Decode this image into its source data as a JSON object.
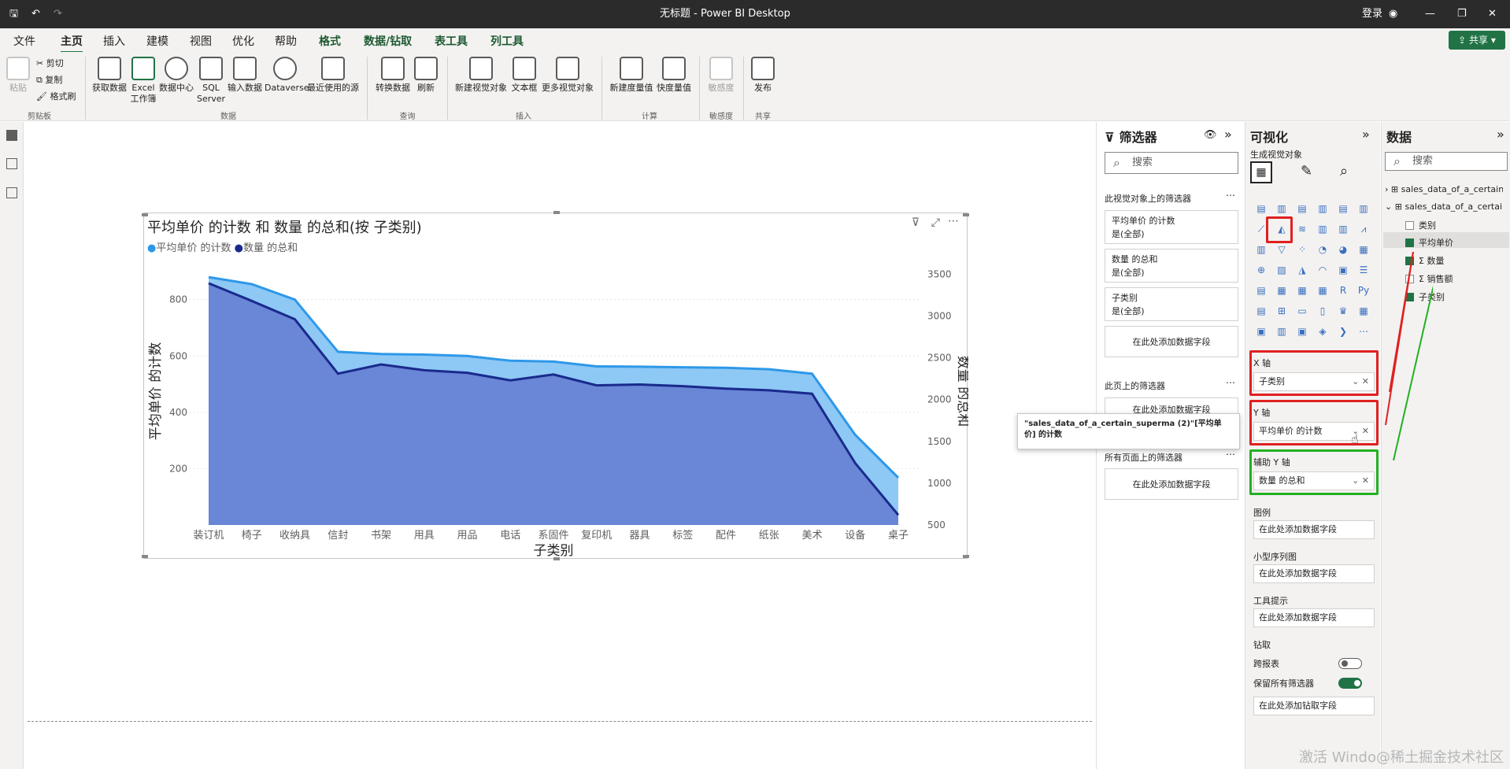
{
  "window": {
    "title": "无标题 - Power BI Desktop",
    "login": "登录",
    "share": "共享"
  },
  "tabs": [
    "文件",
    "主页",
    "插入",
    "建模",
    "视图",
    "优化",
    "帮助",
    "格式",
    "数据/钻取",
    "表工具",
    "列工具"
  ],
  "ribbon": {
    "clipboard": {
      "paste": "粘贴",
      "cut": "剪切",
      "copy": "复制",
      "format_painter": "格式刷",
      "group": "剪贴板"
    },
    "data": {
      "get_data": "获取数据",
      "excel": "Excel\n工作簿",
      "hub": "数据中心",
      "sql": "SQL\nServer",
      "enter": "输入数据",
      "dataverse": "Dataverse",
      "recent": "最近使用的源",
      "group": "数据"
    },
    "query": {
      "transform": "转换数据",
      "refresh": "刷新",
      "group": "查询"
    },
    "insert": {
      "new_visual": "新建视觉对象",
      "textbox": "文本框",
      "more": "更多视觉对象",
      "group": "插入"
    },
    "calc": {
      "new_measure": "新建度量值",
      "quick_measure": "快度量值",
      "group": "计算"
    },
    "sensitivity": {
      "label": "敏感度",
      "group": "敏感度"
    },
    "share": {
      "publish": "发布",
      "group": "共享"
    }
  },
  "visual": {
    "title": "平均单价 的计数 和 数量 的总和(按 子类别)",
    "legend1": "平均单价 的计数",
    "legend2": "数量 的总和"
  },
  "chart_data": {
    "type": "area",
    "title": "平均单价 的计数 和 数量 的总和(按 子类别)",
    "xlabel": "子类别",
    "ylabel": "平均单价 的计数",
    "y2label": "数量 的总和",
    "categories": [
      "装订机",
      "椅子",
      "收纳具",
      "信封",
      "书架",
      "用具",
      "用品",
      "电话",
      "系固件",
      "复印机",
      "器具",
      "标签",
      "配件",
      "纸张",
      "美术",
      "设备",
      "桌子"
    ],
    "series": [
      {
        "name": "平均单价 的计数",
        "axis": "left",
        "color": "#2e98e8",
        "values": [
          880,
          855,
          800,
          615,
          607,
          605,
          600,
          583,
          580,
          563,
          562,
          560,
          558,
          553,
          537,
          320,
          168
        ]
      },
      {
        "name": "数量 的总和",
        "axis": "right",
        "color": "#1a2a8c",
        "values": [
          3390,
          3180,
          2960,
          2310,
          2420,
          2350,
          2320,
          2230,
          2300,
          2170,
          2180,
          2160,
          2130,
          2110,
          2070,
          1240,
          620
        ]
      }
    ],
    "ylim": [
      0,
      950
    ],
    "y2lim": [
      500,
      3700
    ],
    "yticks": [
      200,
      400,
      600,
      800
    ],
    "y2ticks": [
      500,
      1000,
      1500,
      2000,
      2500,
      3000,
      3500
    ]
  },
  "filters": {
    "title": "筛选器",
    "search": "搜索",
    "on_visual": "此视觉对象上的筛选器",
    "cards": [
      {
        "name": "平均单价 的计数",
        "state": "是(全部)"
      },
      {
        "name": "数量 的总和",
        "state": "是(全部)"
      },
      {
        "name": "子类别",
        "state": "是(全部)"
      }
    ],
    "add": "在此处添加数据字段",
    "on_page": "此页上的筛选器",
    "on_page_partial": "在此处添加数据字段",
    "all_pages": "所有页面上的筛选器",
    "add2": "在此处添加数据字段"
  },
  "viz": {
    "title": "可视化",
    "build": "生成视觉对象",
    "xaxis": "X 轴",
    "xfield": "子类别",
    "yaxis": "Y 轴",
    "yfield": "平均单价 的计数",
    "y2axis": "辅助 Y 轴",
    "y2field": "数量 的总和",
    "legend": "图例",
    "legend_add": "在此处添加数据字段",
    "small": "小型序列图",
    "small_add": "在此处添加数据字段",
    "tooltip": "工具提示",
    "tooltip_add": "在此处添加数据字段",
    "drill": "钻取",
    "cross": "跨报表",
    "keep": "保留所有筛选器",
    "drill_add": "在此处添加钻取字段"
  },
  "data_pane": {
    "title": "数据",
    "search": "搜索",
    "tables": [
      "sales_data_of_a_certain...",
      "sales_data_of_a_certain..."
    ],
    "fields": [
      {
        "name": "类别",
        "checked": false
      },
      {
        "name": "平均单价",
        "checked": true
      },
      {
        "name": "数量",
        "checked": true
      },
      {
        "name": "销售额",
        "checked": false
      },
      {
        "name": "子类别",
        "checked": true
      }
    ]
  },
  "hover_tooltip": "\"sales_data_of_a_certain_superma (2)\"[平均单价] 的计数",
  "watermark": "激活 Windo@稀土掘金技术社区"
}
